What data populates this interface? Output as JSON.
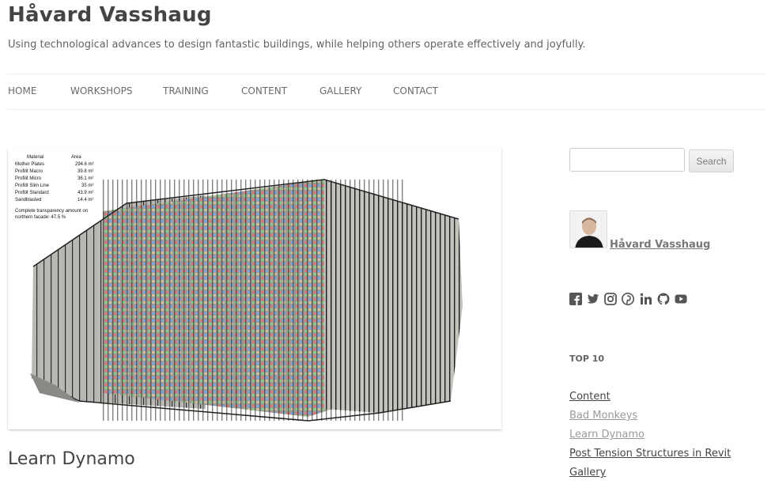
{
  "site": {
    "title": "Håvard Vasshaug",
    "tagline": "Using technological advances to design fantastic buildings, while helping others operate effectively and joyfully."
  },
  "nav": {
    "items": [
      "HOME",
      "WORKSHOPS",
      "TRAINING",
      "CONTENT",
      "GALLERY",
      "CONTACT"
    ]
  },
  "featured": {
    "table_headers": [
      "Material",
      "Area"
    ],
    "rows": [
      {
        "material": "Mother Plates",
        "area": "294.6 m²"
      },
      {
        "material": "Profilit Macro",
        "area": "39.8 m²"
      },
      {
        "material": "Profilit Micro",
        "area": "36.1 m²"
      },
      {
        "material": "Profilit Slim Line",
        "area": "35 m²"
      },
      {
        "material": "Profilit Standard",
        "area": "43.9 m²"
      },
      {
        "material": "Sandblasted",
        "area": "14.4 m²"
      }
    ],
    "note_line1": "Complete transparency amount on",
    "note_line2": "northern facade: 47.5 %"
  },
  "post": {
    "title": "Learn Dynamo"
  },
  "sidebar": {
    "search": {
      "placeholder": "",
      "button": "Search"
    },
    "author": {
      "name": "Håvard Vasshaug"
    },
    "social_icons": [
      "facebook-icon",
      "twitter-icon",
      "instagram-icon",
      "pinterest-icon",
      "linkedin-icon",
      "github-icon",
      "youtube-icon"
    ],
    "top10": {
      "title": "TOP 10",
      "links": [
        "Content",
        "Bad Monkeys",
        "Learn Dynamo",
        "Post Tension Structures in Revit",
        "Gallery"
      ]
    }
  },
  "colors": {
    "text": "#444444",
    "muted": "#9a9a9a",
    "glass_red": "#d77a7e",
    "glass_blue": "#7ea7d9",
    "glass_green": "#8fc88b",
    "glass_beige": "#cbbfa4"
  }
}
